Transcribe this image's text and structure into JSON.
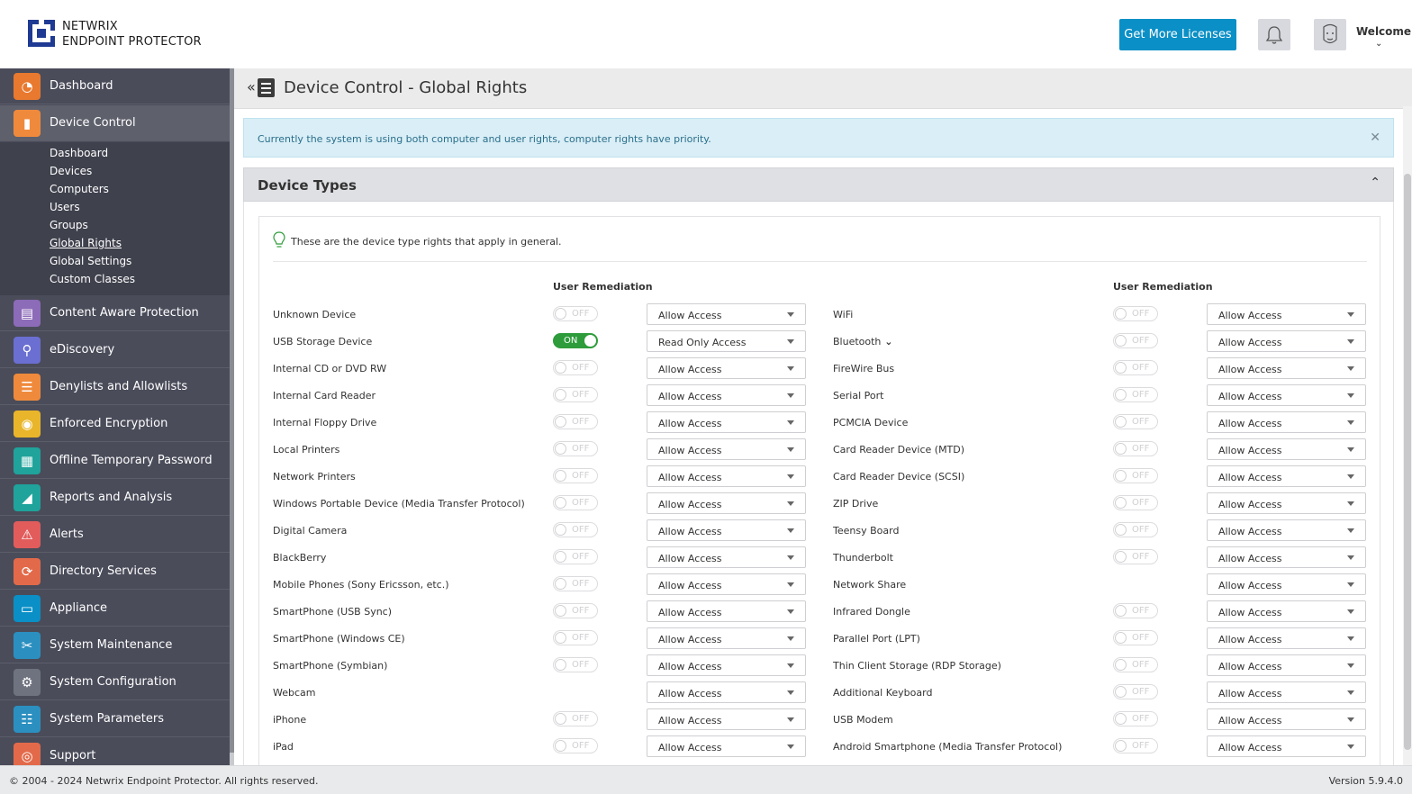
{
  "header": {
    "brand_line1": "NETWRIX",
    "brand_line2": "ENDPOINT PROTECTOR",
    "licenses_button": "Get More Licenses",
    "welcome": "Welcome"
  },
  "sidebar": {
    "items": [
      {
        "label": "Dashboard",
        "icon": "dashboard-icon",
        "color": "#e8792e"
      },
      {
        "label": "Device Control",
        "icon": "usb-icon",
        "color": "#ef8a3c"
      },
      {
        "label": "Content Aware Protection",
        "icon": "content-icon",
        "color": "#8c6bb8"
      },
      {
        "label": "eDiscovery",
        "icon": "telescope-icon",
        "color": "#6b6fd1"
      },
      {
        "label": "Denylists and Allowlists",
        "icon": "list-icon",
        "color": "#ef8a3c"
      },
      {
        "label": "Enforced Encryption",
        "icon": "lock-icon",
        "color": "#e9b52a"
      },
      {
        "label": "Offline Temporary Password",
        "icon": "password-icon",
        "color": "#1fa39b"
      },
      {
        "label": "Reports and Analysis",
        "icon": "chart-icon",
        "color": "#1fa39b"
      },
      {
        "label": "Alerts",
        "icon": "warning-icon",
        "color": "#e25c5c"
      },
      {
        "label": "Directory Services",
        "icon": "directory-icon",
        "color": "#e26a4a"
      },
      {
        "label": "Appliance",
        "icon": "appliance-icon",
        "color": "#0a8fc6"
      },
      {
        "label": "System Maintenance",
        "icon": "tools-icon",
        "color": "#2b8fc0"
      },
      {
        "label": "System Configuration",
        "icon": "gear-icon",
        "color": "#6f7380"
      },
      {
        "label": "System Parameters",
        "icon": "parameters-icon",
        "color": "#2b8fc0"
      },
      {
        "label": "Support",
        "icon": "lifebuoy-icon",
        "color": "#e26a4a"
      }
    ],
    "sub_items": [
      "Dashboard",
      "Devices",
      "Computers",
      "Users",
      "Groups",
      "Global Rights",
      "Global Settings",
      "Custom Classes"
    ]
  },
  "main": {
    "page_title": "Device Control - Global Rights",
    "alert": "Currently the system is using both computer and user rights, computer rights have priority.",
    "panel_title": "Device Types",
    "hint": "These are the device type rights that apply in general.",
    "col_user_remediation": "User Remediation",
    "toggle_off": "OFF",
    "toggle_on": "ON",
    "left_rows": [
      {
        "name": "Unknown Device",
        "toggle": "off",
        "access": "Allow Access"
      },
      {
        "name": "USB Storage Device",
        "toggle": "on",
        "access": "Read Only Access"
      },
      {
        "name": "Internal CD or DVD RW",
        "toggle": "off",
        "access": "Allow Access"
      },
      {
        "name": "Internal Card Reader",
        "toggle": "off",
        "access": "Allow Access"
      },
      {
        "name": "Internal Floppy Drive",
        "toggle": "off",
        "access": "Allow Access"
      },
      {
        "name": "Local Printers",
        "toggle": "off",
        "access": "Allow Access"
      },
      {
        "name": "Network Printers",
        "toggle": "off",
        "access": "Allow Access"
      },
      {
        "name": "Windows Portable Device (Media Transfer Protocol)",
        "toggle": "off",
        "access": "Allow Access"
      },
      {
        "name": "Digital Camera",
        "toggle": "off",
        "access": "Allow Access"
      },
      {
        "name": "BlackBerry",
        "toggle": "off",
        "access": "Allow Access"
      },
      {
        "name": "Mobile Phones (Sony Ericsson, etc.)",
        "toggle": "off",
        "access": "Allow Access"
      },
      {
        "name": "SmartPhone (USB Sync)",
        "toggle": "off",
        "access": "Allow Access"
      },
      {
        "name": "SmartPhone (Windows CE)",
        "toggle": "off",
        "access": "Allow Access"
      },
      {
        "name": "SmartPhone (Symbian)",
        "toggle": "off",
        "access": "Allow Access"
      },
      {
        "name": "Webcam",
        "toggle": "none",
        "access": "Allow Access"
      },
      {
        "name": "iPhone",
        "toggle": "off",
        "access": "Allow Access"
      },
      {
        "name": "iPad",
        "toggle": "off",
        "access": "Allow Access"
      }
    ],
    "right_rows": [
      {
        "name": "WiFi",
        "toggle": "off",
        "access": "Allow Access"
      },
      {
        "name": "Bluetooth",
        "toggle": "off",
        "access": "Allow Access",
        "expand": true
      },
      {
        "name": "FireWire Bus",
        "toggle": "off",
        "access": "Allow Access"
      },
      {
        "name": "Serial Port",
        "toggle": "off",
        "access": "Allow Access"
      },
      {
        "name": "PCMCIA Device",
        "toggle": "off",
        "access": "Allow Access"
      },
      {
        "name": "Card Reader Device (MTD)",
        "toggle": "off",
        "access": "Allow Access"
      },
      {
        "name": "Card Reader Device (SCSI)",
        "toggle": "off",
        "access": "Allow Access"
      },
      {
        "name": "ZIP Drive",
        "toggle": "off",
        "access": "Allow Access"
      },
      {
        "name": "Teensy Board",
        "toggle": "off",
        "access": "Allow Access"
      },
      {
        "name": "Thunderbolt",
        "toggle": "off",
        "access": "Allow Access"
      },
      {
        "name": "Network Share",
        "toggle": "none",
        "access": "Allow Access"
      },
      {
        "name": "Infrared Dongle",
        "toggle": "off",
        "access": "Allow Access"
      },
      {
        "name": "Parallel Port (LPT)",
        "toggle": "off",
        "access": "Allow Access"
      },
      {
        "name": "Thin Client Storage (RDP Storage)",
        "toggle": "off",
        "access": "Allow Access"
      },
      {
        "name": "Additional Keyboard",
        "toggle": "off",
        "access": "Allow Access"
      },
      {
        "name": "USB Modem",
        "toggle": "off",
        "access": "Allow Access"
      },
      {
        "name": "Android Smartphone (Media Transfer Protocol)",
        "toggle": "off",
        "access": "Allow Access"
      }
    ]
  },
  "footer": {
    "copyright": "© 2004 - 2024 Netwrix Endpoint Protector. All rights reserved.",
    "version": "Version 5.9.4.0"
  }
}
